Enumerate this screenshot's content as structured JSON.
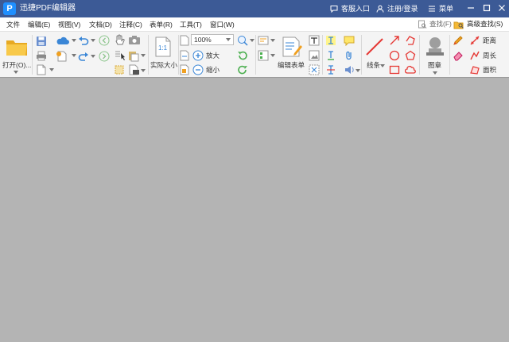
{
  "titlebar": {
    "logo_letter": "P",
    "title": "迅捷PDF编辑器",
    "feedback": "客服入口",
    "login": "注册/登录",
    "menu": "菜单"
  },
  "menubar": {
    "items": [
      "文件",
      "编辑(E)",
      "视图(V)",
      "文档(D)",
      "注释(C)",
      "表单(R)",
      "工具(T)",
      "窗口(W)"
    ],
    "search": "查找(F)",
    "advanced_search": "高级查找(S)"
  },
  "toolbar": {
    "open": "打开(O)...",
    "actual_size": "实际大小",
    "zoom_value": "100%",
    "zoom_in": "放大",
    "zoom_out": "缩小",
    "edit_form": "编辑表单",
    "line": "线条",
    "stamp": "图章",
    "distance": "距离",
    "perimeter": "周长",
    "area": "面积"
  },
  "colors": {
    "titlebar_bg": "#3c5a96",
    "toolbar_bg": "#f4f4f4",
    "workspace_bg": "#b4b4b4",
    "accent_blue": "#1f8fff"
  }
}
